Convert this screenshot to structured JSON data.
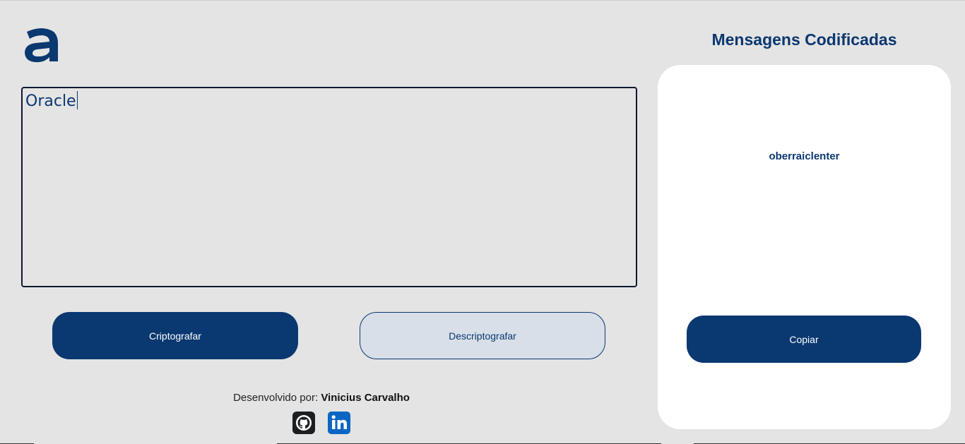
{
  "header": {
    "logo_icon": "alura-a-logo-icon"
  },
  "input": {
    "value": "Oracle"
  },
  "buttons": {
    "encrypt_label": "Criptografar",
    "decrypt_label": "Descriptografar"
  },
  "footer": {
    "prefix": "Desenvolvido por:",
    "author": "Vinicius Carvalho",
    "social_icons": [
      "github-icon",
      "linkedin-icon"
    ]
  },
  "aside": {
    "title": "Mensagens Codificadas",
    "output_value": "oberraiclenter",
    "copy_label": "Copiar"
  },
  "colors": {
    "primary": "#0a3871",
    "background": "#e4e4e4",
    "panel": "#ffffff",
    "decrypt_bg": "#d8dfe8",
    "linkedin": "#0a66c2"
  }
}
